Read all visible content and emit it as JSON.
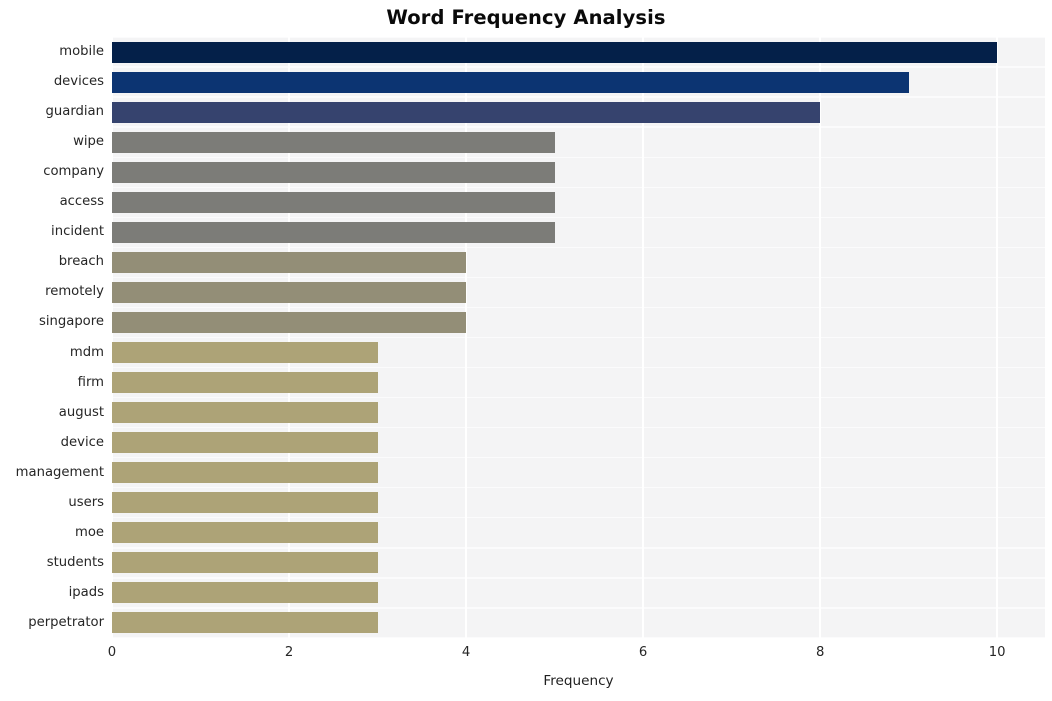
{
  "chart_data": {
    "type": "bar",
    "orientation": "horizontal",
    "title": "Word Frequency Analysis",
    "xlabel": "Frequency",
    "ylabel": "",
    "xlim": [
      0,
      10.54
    ],
    "xticks": [
      0,
      2,
      4,
      6,
      8,
      10
    ],
    "xticklabels": [
      "0",
      "2",
      "4",
      "6",
      "8",
      "10"
    ],
    "grid": true,
    "grid_color": "#ffffff",
    "plot_background": "#f4f4f5",
    "figure_background": "#ffffff",
    "legend": null,
    "categories": [
      "mobile",
      "devices",
      "guardian",
      "wipe",
      "company",
      "access",
      "incident",
      "breach",
      "remotely",
      "singapore",
      "mdm",
      "firm",
      "august",
      "device",
      "management",
      "users",
      "moe",
      "students",
      "ipads",
      "perpetrator"
    ],
    "values": [
      10,
      9,
      8,
      5,
      5,
      5,
      5,
      4,
      4,
      4,
      3,
      3,
      3,
      3,
      3,
      3,
      3,
      3,
      3,
      3
    ],
    "bar_colors": [
      "#042049",
      "#0c3472",
      "#36436e",
      "#7c7c78",
      "#7c7c78",
      "#7c7c78",
      "#7c7c78",
      "#938e77",
      "#938e77",
      "#938e77",
      "#ada377",
      "#ada377",
      "#ada377",
      "#ada377",
      "#ada377",
      "#ada377",
      "#ada377",
      "#ada377",
      "#ada377",
      "#ada377"
    ]
  }
}
